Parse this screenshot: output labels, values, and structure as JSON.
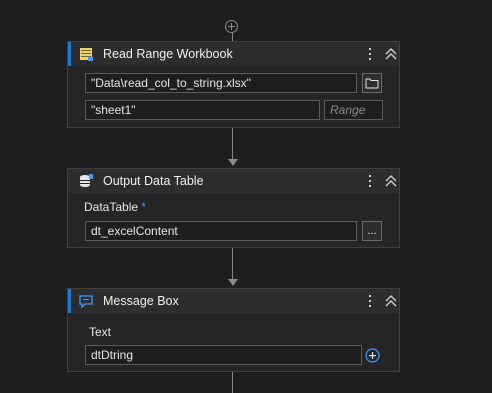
{
  "activities": {
    "read_range": {
      "title": "Read Range Workbook",
      "icon": "spreadsheet-icon",
      "workbook_path": "\"Data\\read_col_to_string.xlsx\"",
      "sheet_name": "\"sheet1\"",
      "range_placeholder": "Range"
    },
    "output_table": {
      "title": "Output Data Table",
      "icon": "database-icon",
      "datatable_label": "DataTable",
      "required_marker": "*",
      "datatable_value": "dt_excelContent",
      "ellipsis": "..."
    },
    "message_box": {
      "title": "Message Box",
      "icon": "message-icon",
      "text_label": "Text",
      "text_value": "dtDtring"
    }
  },
  "colors": {
    "accent": "#1f7ad6",
    "background": "#1e1e1e",
    "card": "#252526",
    "connector": "#8a8a8a"
  }
}
